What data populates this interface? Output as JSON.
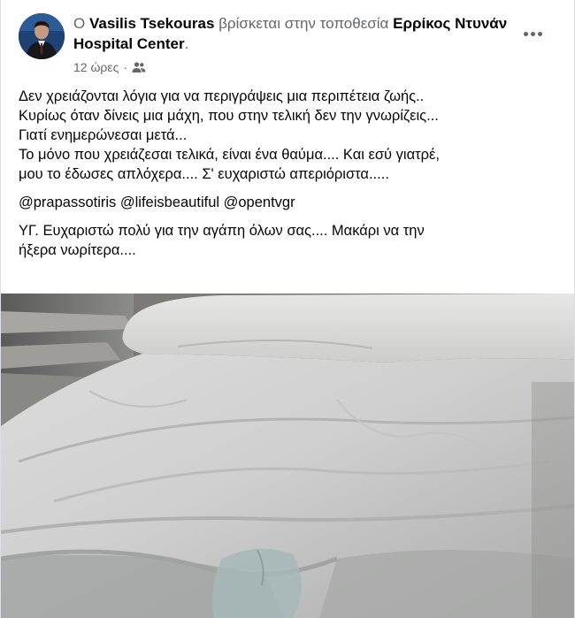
{
  "post": {
    "author_prefix": "Ο",
    "author": "Vasilis Tsekouras",
    "location_connector": "βρίσκεται στην τοποθεσία",
    "location": "Ερρίκος Ντυνάν Hospital Center",
    "location_suffix": ".",
    "time": "12 ώρες",
    "separator": "·",
    "audience_icon": "friends-icon",
    "more_icon": "more-horiz-icon",
    "lines": [
      "Δεν χρειάζονται λόγια για να περιγράψεις μια περιπέτεια ζωής..",
      "Κυρίως όταν δίνεις μια μάχη, που στην τελική δεν την γνωρίζεις...",
      "Γιατί ενημερώνεσαι μετά...",
      "Το μόνο που χρειάζεσαι τελικά, είναι ένα θαύμα.... Και εσύ γιατρέ,",
      "μου το έδωσες απλόχερα....  Σ' ευχαριστώ απεριόριστα....."
    ],
    "mentions": [
      "@prapassotiris",
      "@lifeisbeautiful",
      "@opentvgr"
    ],
    "ps_lines": [
      "ΥΓ. Ευχαριστώ πολύ για την αγάπη όλων σας.... Μακάρι να την",
      "ήξερα νωρίτερα...."
    ]
  }
}
